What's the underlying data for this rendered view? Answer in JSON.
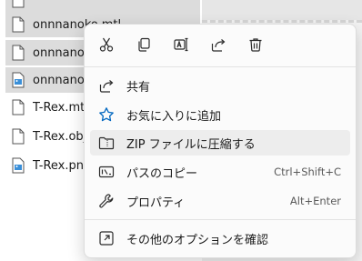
{
  "files": [
    {
      "name": "",
      "selected": true,
      "icon": "document-icon"
    },
    {
      "name": "onnnanoko.mtl",
      "selected": true,
      "icon": "document-icon"
    },
    {
      "name": "onnnanoko.obj",
      "selected": true,
      "icon": "document-icon"
    },
    {
      "name": "onnnanoko.png",
      "selected": true,
      "icon": "image-file-icon"
    },
    {
      "name": "T-Rex.mtl",
      "selected": false,
      "icon": "document-icon"
    },
    {
      "name": "T-Rex.obj",
      "selected": false,
      "icon": "document-icon"
    },
    {
      "name": "T-Rex.png",
      "selected": false,
      "icon": "image-file-icon"
    }
  ],
  "context_menu": {
    "toolbar_icons": [
      "cut-icon",
      "copy-icon",
      "rename-icon",
      "share-icon",
      "delete-icon"
    ],
    "items": [
      {
        "label": "共有",
        "shortcut": "",
        "icon": "share-icon"
      },
      {
        "label": "お気に入りに追加",
        "shortcut": "",
        "icon": "star-icon"
      },
      {
        "label": "ZIP ファイルに圧縮する",
        "shortcut": "",
        "icon": "zip-folder-icon"
      },
      {
        "label": "パスのコピー",
        "shortcut": "Ctrl+Shift+C",
        "icon": "copy-path-icon"
      },
      {
        "label": "プロパティ",
        "shortcut": "Alt+Enter",
        "icon": "wrench-icon"
      },
      {
        "label": "その他のオプションを確認",
        "shortcut": "",
        "icon": "more-options-icon"
      }
    ]
  },
  "colors": {
    "accent": "#0067c0",
    "selection": "#dcdcdc",
    "menu_background": "#fbfbfb"
  }
}
